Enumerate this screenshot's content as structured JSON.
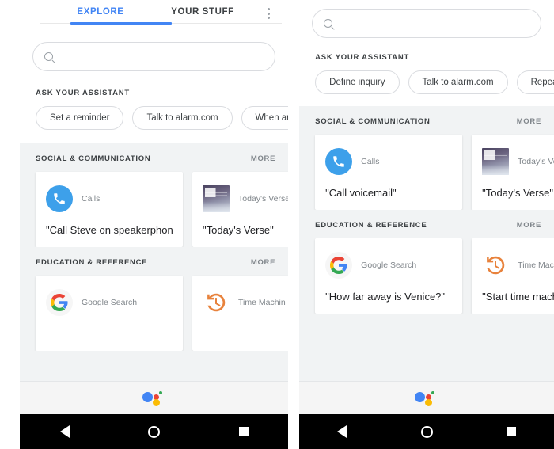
{
  "panels": [
    {
      "id": "explore-panel",
      "has_tabs": true,
      "tabs": [
        {
          "label": "EXPLORE",
          "active": true
        },
        {
          "label": "YOUR STUFF",
          "active": false
        }
      ],
      "overflow_menu_icon": "more-vertical-icon",
      "search": {
        "icon": "search-icon",
        "value": "",
        "placeholder": ""
      },
      "ask_label": "ASK YOUR ASSISTANT",
      "chips": [
        "Set a reminder",
        "Talk to alarm.com",
        "When are the S"
      ],
      "categories": [
        {
          "title": "SOCIAL & COMMUNICATION",
          "more_label": "MORE",
          "cards": [
            {
              "icon": "phone-call-icon",
              "provider": "Calls",
              "query": "\"Call Steve on speakerphone\""
            },
            {
              "icon": "todays-verse-thumbnail",
              "provider": "Today's Verse",
              "query": "\"Today's Verse\""
            }
          ]
        },
        {
          "title": "EDUCATION & REFERENCE",
          "more_label": "MORE",
          "cards": [
            {
              "icon": "google-logo-icon",
              "provider": "Google Search",
              "query": ""
            },
            {
              "icon": "time-machine-icon",
              "provider": "Time Machin",
              "query": ""
            }
          ]
        }
      ],
      "assistant_bar_icon": "google-assistant-icon",
      "navbar": {
        "back": "back-triangle-icon",
        "home": "home-circle-icon",
        "recents": "recents-square-icon"
      }
    },
    {
      "id": "explore-panel-scrolled",
      "has_tabs": false,
      "tabs": [],
      "overflow_menu_icon": "",
      "search": {
        "icon": "search-icon",
        "value": "",
        "placeholder": ""
      },
      "ask_label": "ASK YOUR ASSISTANT",
      "chips": [
        "Define inquiry",
        "Talk to alarm.com",
        "Repeat after m"
      ],
      "categories": [
        {
          "title": "SOCIAL & COMMUNICATION",
          "more_label": "MORE",
          "cards": [
            {
              "icon": "phone-call-icon",
              "provider": "Calls",
              "query": "\"Call voicemail\""
            },
            {
              "icon": "todays-verse-thumbnail",
              "provider": "Today's Verse",
              "query": "\"Today's Verse\""
            }
          ]
        },
        {
          "title": "EDUCATION & REFERENCE",
          "more_label": "MORE",
          "cards": [
            {
              "icon": "google-logo-icon",
              "provider": "Google Search",
              "query": "\"How far away is Venice?\""
            },
            {
              "icon": "time-machine-icon",
              "provider": "Time Machin",
              "query": "\"Start time machin"
            }
          ]
        }
      ],
      "assistant_bar_icon": "google-assistant-icon",
      "navbar": {
        "back": "back-triangle-icon",
        "home": "home-circle-icon",
        "recents": "recents-square-icon"
      }
    }
  ],
  "colors": {
    "accent_blue": "#4285f4",
    "calls_blue": "#3da0ea",
    "time_machine_orange": "#e8823c",
    "google_red": "#ea4335",
    "google_yellow": "#fbbc05",
    "google_green": "#34a853",
    "content_bg": "#f1f3f4"
  }
}
